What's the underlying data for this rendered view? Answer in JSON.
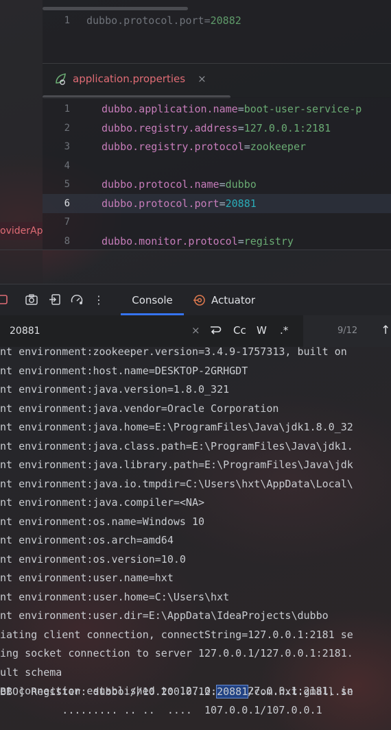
{
  "top_editor": {
    "lines": [
      {
        "num": "1",
        "key": "dubbo.protocol.port",
        "eq": "=",
        "value": "20882"
      }
    ]
  },
  "tab": {
    "icon": "spring-leaf-icon",
    "label": "application.properties",
    "close": "×"
  },
  "editor": {
    "lines": [
      {
        "num": "1",
        "key": "dubbo.application.name",
        "eq": "=",
        "value": "boot-user-service-p"
      },
      {
        "num": "2",
        "key": "dubbo.registry.address",
        "eq": "=",
        "value": "127.0.0.1:2181"
      },
      {
        "num": "3",
        "key": "dubbo.registry.protocol",
        "eq": "=",
        "value": "zookeeper"
      },
      {
        "num": "4",
        "key": "",
        "eq": "",
        "value": ""
      },
      {
        "num": "5",
        "key": "dubbo.protocol.name",
        "eq": "=",
        "value": "dubbo"
      },
      {
        "num": "6",
        "key": "dubbo.protocol.port",
        "eq": "=",
        "value": "20881"
      },
      {
        "num": "7",
        "key": "",
        "eq": "",
        "value": ""
      },
      {
        "num": "8",
        "key": "dubbo.monitor.protocol",
        "eq": "=",
        "value": "registry"
      }
    ]
  },
  "project_panel": {
    "item": "oviderAp"
  },
  "toolbar": {
    "console_label": "Console",
    "actuator_label": "Actuator",
    "more": "⋮"
  },
  "search": {
    "value": "20881",
    "clear": "×",
    "case": "Cc",
    "word": "W",
    "regex": ".*",
    "count": "9/12",
    "prev": "↑"
  },
  "console": {
    "lines": [
      "nt environment:zookeeper.version=3.4.9-1757313, built on",
      "nt environment:host.name=DESKTOP-2GRHGDT",
      "nt environment:java.version=1.8.0_321",
      "nt environment:java.vendor=Oracle Corporation",
      "nt environment:java.home=E:\\ProgramFiles\\Java\\jdk1.8.0_32",
      "nt environment:java.class.path=E:\\ProgramFiles\\Java\\jdk1.",
      "nt environment:java.library.path=E:\\ProgramFiles\\Java\\jdk",
      "nt environment:java.io.tmpdir=C:\\Users\\hxt\\AppData\\Local\\",
      "nt environment:java.compiler=<NA>",
      "nt environment:os.name=Windows 10",
      "nt environment:os.arch=amd64",
      "nt environment:os.version=10.0",
      "nt environment:user.name=hxt",
      "nt environment:user.home=C:\\Users\\hxt",
      "nt environment:user.dir=E:\\AppData\\IdeaProjects\\dubbo",
      "iating client connection, connectString=127.0.0.1:2181 se",
      "ing socket connection to server 127.0.0.1/127.0.0.1:2181.",
      "ult schema",
      "et connection established to 127.0.0.1/127.0.0.1:2181, in"
    ],
    "register_line": {
      "prefix": "BBO] Register: dubbo://10.200.0.12:",
      "match": "20881",
      "suffix": "/com.hxt.gmall.se"
    },
    "partial_line": "          ......... .. ..  ....  107.0.0.1/107.0.0.1"
  },
  "colors": {
    "key": "#c77dbb",
    "value": "#6aab73",
    "number": "#2aacb8",
    "accent": "#3574f0",
    "tab_label": "#e06c75"
  }
}
